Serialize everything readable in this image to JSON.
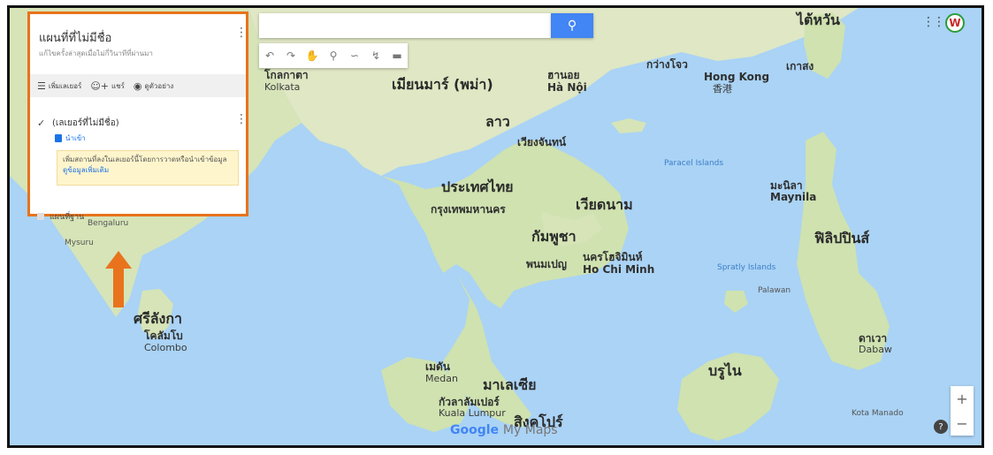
{
  "app": {
    "logo_g": "Google",
    "logo_my": "My Maps"
  },
  "panel": {
    "title": "แผนที่ที่ไม่มีชื่อ",
    "subtitle": "แก้ไขครั้งล่าสุดเมื่อไม่กี่วินาทีที่ผ่านมา",
    "actions": [
      {
        "icon": "layers-icon",
        "label": "เพิ่มเลเยอร์"
      },
      {
        "icon": "share-icon",
        "label": "แชร์"
      },
      {
        "icon": "preview-icon",
        "label": "ดูตัวอย่าง"
      }
    ],
    "layer_name": "(เลเยอร์ที่ไม่มีชื่อ)",
    "import_label": "นำเข้า",
    "info_text": "เพิ่มสถานที่ลงในเลเยอร์นี้โดยการวาดหรือนำเข้าข้อมูล",
    "info_link": "ดูข้อมูลเพิ่มเติม",
    "base_map": "แผนที่ฐาน"
  },
  "map_labels": {
    "myanmar": "เมียนมาร์ (พม่า)",
    "laos": "ลาว",
    "thailand": "ประเทศไทย",
    "bangkok": "กรุงเทพมหานคร",
    "vietnam": "เวียดนาม",
    "cambodia": "กัมพูชา",
    "phnom_penh": "พนมเปญ",
    "hcmc": "นครโฮจิมินห์",
    "hcmc_en": "Ho Chi Minh",
    "hanoi": "ฮานอย",
    "hanoi_en": "Hà Nội",
    "vientiane": "เวียงจันทน์",
    "kolkata": "โกลกาตา",
    "kolkata_en": "Kolkata",
    "hong_kong": "Hong Kong",
    "hong_kong_zh": "香港",
    "guangzhou": "กว่างโจว",
    "taiwan": "ไต้หวัน",
    "kaohsiung": "เกาสง",
    "philippines": "ฟิลิปปินส์",
    "manila": "มะนิลา",
    "manila_en": "Maynila",
    "sri_lanka": "ศรีลังกา",
    "colombo": "โคลัมโบ",
    "colombo_en": "Colombo",
    "malaysia": "มาเลเซีย",
    "kuala_lumpur": "กัวลาลัมเปอร์",
    "kuala_lumpur_en": "Kuala Lumpur",
    "singapore": "สิงคโปร์",
    "medan": "เมดัน",
    "medan_en": "Medan",
    "brunei": "บรูไน",
    "davao": "ดาเวา",
    "davao_en": "Dabaw",
    "kota_manado": "Kota Manado",
    "mysuru": "Mysuru",
    "bengaluru": "Bengaluru",
    "paracel": "Paracel Islands",
    "spratly": "Spratly Islands",
    "palawan": "Palawan"
  }
}
